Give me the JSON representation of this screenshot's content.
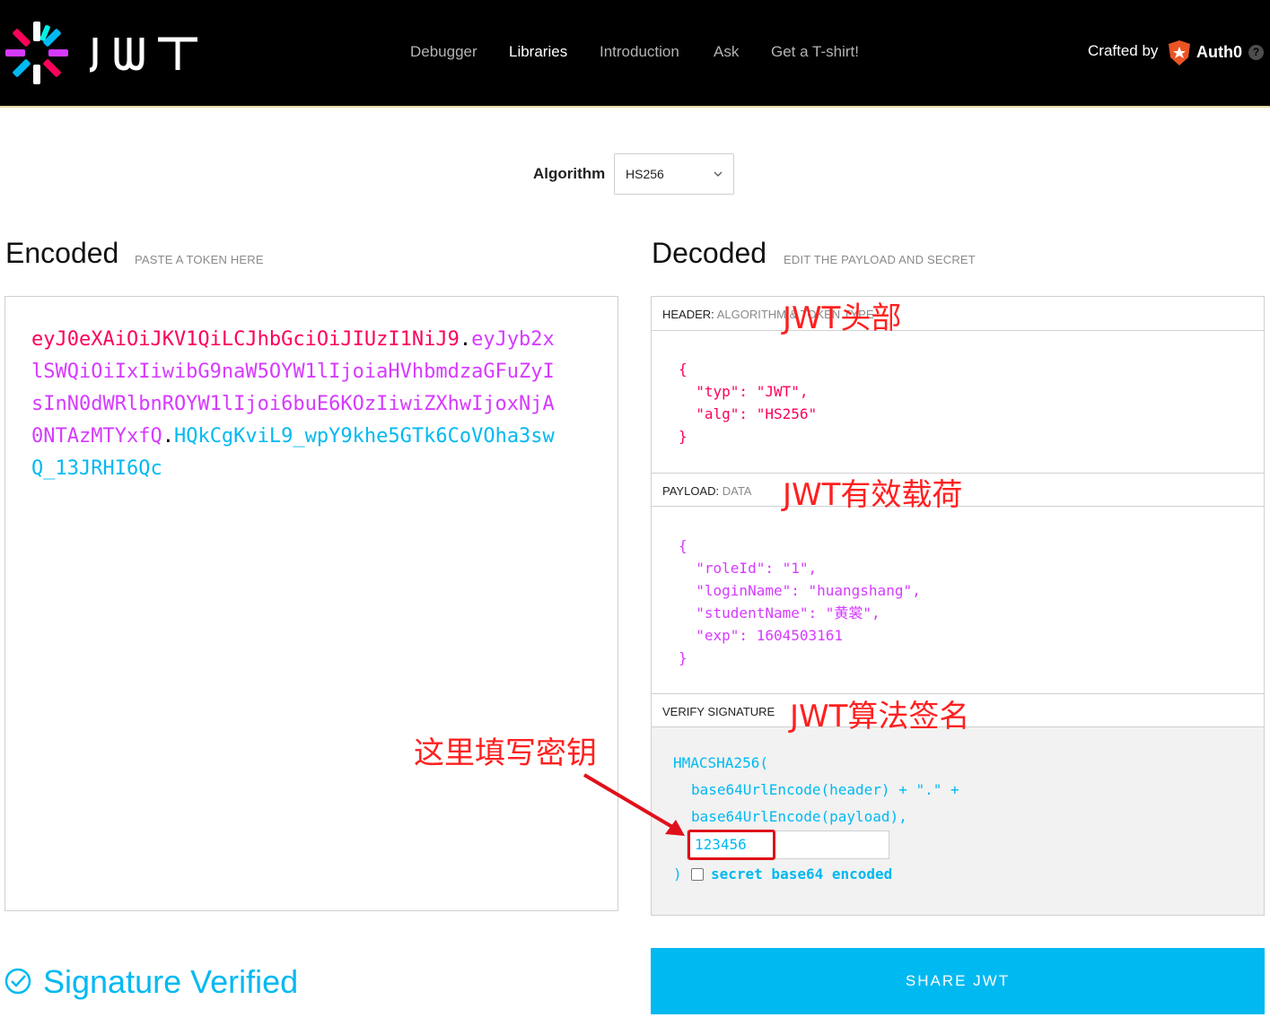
{
  "nav": {
    "brand": "JWT",
    "items": [
      "Debugger",
      "Libraries",
      "Introduction",
      "Ask",
      "Get a T-shirt!"
    ],
    "active": "Libraries",
    "crafted_by": "Crafted by",
    "auth0": "Auth0",
    "help": "?"
  },
  "algorithm": {
    "label": "Algorithm",
    "value": "HS256"
  },
  "encoded": {
    "title": "Encoded",
    "subtitle": "PASTE A TOKEN HERE",
    "header_seg": "eyJ0eXAiOiJKV1QiLCJhbGciOiJIUzI1NiJ9",
    "payload_seg": "eyJyb2xlSWQiOiIxIiwibG9naW5OYW1lIjoiaHVhbmdzaGFuZyIsInN0dWRlbnROYW1lIjoi6buE6KOzIiwiZXhwIjoxNjA0NTAzMTYxfQ",
    "sig_seg": "HQkCgKviL9_wpY9khe5GTk6CoVOha3swQ_13JRHI6Qc",
    "dot": "."
  },
  "decoded": {
    "title": "Decoded",
    "subtitle": "EDIT THE PAYLOAD AND SECRET",
    "header_label": "HEADER:",
    "header_sub": "ALGORITHM & TOKEN TYPE",
    "header_json": "{\n  \"typ\": \"JWT\",\n  \"alg\": \"HS256\"\n}",
    "payload_label": "PAYLOAD:",
    "payload_sub": "DATA",
    "payload_json": "{\n  \"roleId\": \"1\",\n  \"loginName\": \"huangshang\",\n  \"studentName\": \"黄裳\",\n  \"exp\": 1604503161\n}",
    "verify_label": "VERIFY SIGNATURE",
    "sig_line1": "HMACSHA256(",
    "sig_line2": "base64UrlEncode(header) + \".\" +",
    "sig_line3": "base64UrlEncode(payload),",
    "secret_value": "123456",
    "sig_close": ")",
    "secret_b64_label": "secret base64 encoded"
  },
  "annotations": {
    "header_note": "JWT头部",
    "payload_note": "JWT有效载荷",
    "signature_note": "JWT算法签名",
    "secret_note": "这里填写密钥"
  },
  "status": {
    "verified": "Signature Verified"
  },
  "share_button": "SHARE JWT",
  "colors": {
    "header": "#fb015b",
    "payload": "#d63aff",
    "signature": "#00b9f1",
    "annotation": "#ff2020"
  }
}
